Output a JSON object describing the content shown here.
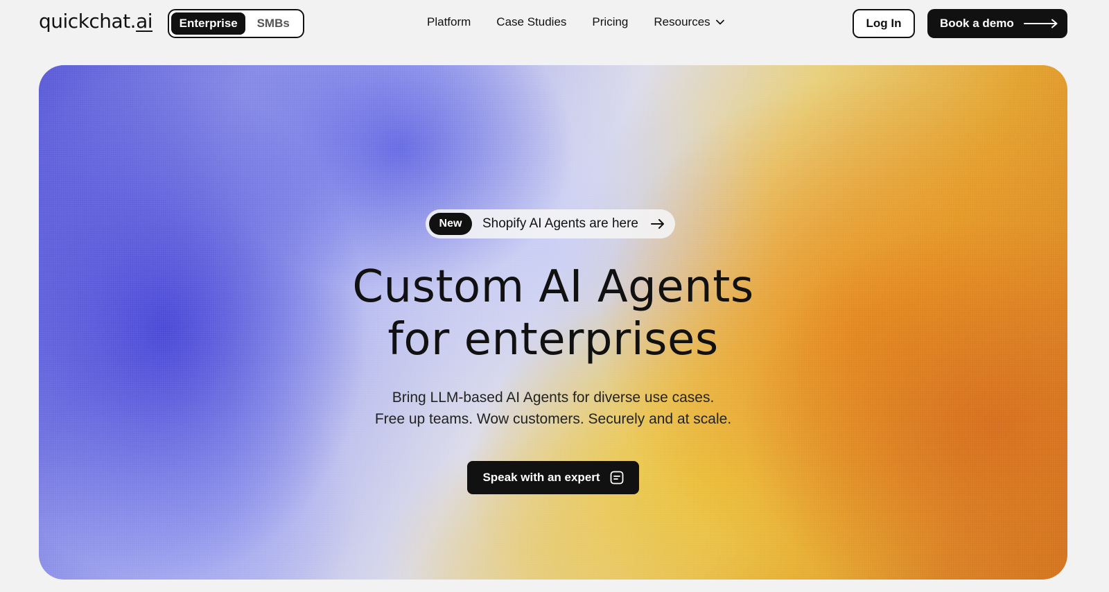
{
  "header": {
    "logo_main": "quickchat.",
    "logo_ai": "ai",
    "segment": {
      "active": "Enterprise",
      "inactive": "SMBs"
    },
    "nav": [
      "Platform",
      "Case Studies",
      "Pricing",
      "Resources"
    ],
    "login_label": "Log In",
    "demo_label": "Book a demo"
  },
  "hero": {
    "badge": "New",
    "announcement": "Shopify AI Agents are here",
    "headline_line1": "Custom AI Agents",
    "headline_line2": "for enterprises",
    "sub_line1": "Bring LLM-based AI Agents for diverse use cases.",
    "sub_line2": "Free up teams. Wow customers. Securely and at scale.",
    "cta_label": "Speak with an expert"
  },
  "icons": {
    "resources_chevron": "chevron-down-icon",
    "demo_arrow": "long-arrow-right-icon",
    "announce_arrow": "arrow-right-icon",
    "cta_icon": "chat-icon"
  },
  "colors": {
    "background": "#f2f2f2",
    "primary": "#111111",
    "hero_blue": "#5a5ad8",
    "hero_yellow": "#ecc43c",
    "hero_orange": "#d4741e"
  }
}
